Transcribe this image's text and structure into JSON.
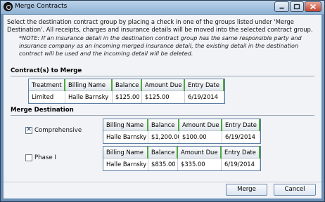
{
  "window": {
    "title": "Merge Contracts"
  },
  "instructions": {
    "text": "Select the destination contract group by placing a check in one of the groups listed under 'Merge Destination'.  All receipts, charges and insurance details will be moved into the selected contract group.",
    "note": "*NOTE:  If an insurance detail in the destination contract group has the same responsible party and insurance company as an incoming merged insurance detail, the existing detail in the destination contract will be used and the incoming detail will be deleted."
  },
  "contracts_to_merge": {
    "label": "Contract(s) to Merge",
    "columns": [
      "Treatment",
      "Billing Name",
      "Balance",
      "Amount Due",
      "Entry Date"
    ],
    "rows": [
      [
        "Limited",
        "Halle Barnsky",
        "$125.00",
        "$125.00",
        "6/19/2014"
      ]
    ]
  },
  "merge_destination": {
    "label": "Merge Destination",
    "groups": [
      {
        "name": "Comprehensive",
        "checked": true,
        "check_mark": "✕",
        "columns": [
          "Billing Name",
          "Balance",
          "Amount Due",
          "Entry Date"
        ],
        "row": [
          "Halle Barnsky",
          "$1,200.00",
          "$100.00",
          "6/19/2014"
        ]
      },
      {
        "name": "Phase I",
        "checked": false,
        "check_mark": "",
        "columns": [
          "Billing Name",
          "Balance",
          "Amount Due",
          "Entry Date"
        ],
        "row": [
          "Halle Barnsky",
          "$835.00",
          "$335.00",
          "6/19/2014"
        ]
      }
    ]
  },
  "buttons": {
    "merge": "Merge",
    "cancel": "Cancel"
  }
}
